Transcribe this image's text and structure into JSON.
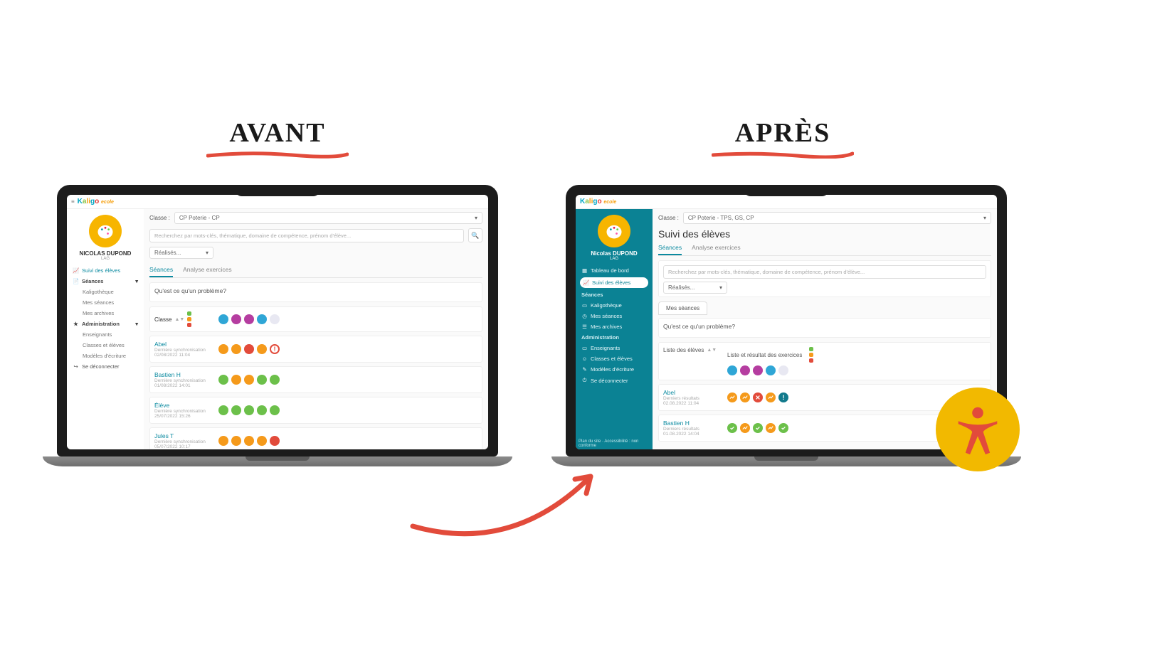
{
  "headings": {
    "before": "AVANT",
    "after": "APRÈS"
  },
  "brand": {
    "name": "Kaligo",
    "sub": "ecole"
  },
  "colors": {
    "teal_sidebar": "#0b8294",
    "accent_teal": "#0b8aa0",
    "badge_yellow": "#f2b900",
    "badge_icon": "#e24b3b"
  },
  "before": {
    "user": {
      "name": "NICOLAS DUPOND",
      "sub": "LAG"
    },
    "nav": {
      "suivi": "Suivi des élèves",
      "seances": "Séances",
      "kaligotheque": "Kaligothèque",
      "mes_seances": "Mes séances",
      "mes_archives": "Mes archives",
      "administration": "Administration",
      "enseignants": "Enseignants",
      "classes_eleves": "Classes et élèves",
      "modeles_ecriture": "Modèles d'écriture",
      "deconnecter": "Se déconnecter"
    },
    "classe_label": "Classe :",
    "classe_value": "CP Poterie - CP",
    "search_placeholder": "Recherchez par mots-clés, thématique, domaine de compétence, prénom d'élève...",
    "filter_value": "Réalisés...",
    "tabs": {
      "seances": "Séances",
      "analyse": "Analyse exercices"
    },
    "panel_title": "Qu'est ce qu'un problème?",
    "header_col1": "Classe",
    "students": [
      {
        "name": "Abel",
        "meta1": "Dernière synchronisation",
        "meta2": "02/08/2022 11:04"
      },
      {
        "name": "Bastien H",
        "meta1": "Dernière synchronisation",
        "meta2": "01/08/2022 14:01"
      },
      {
        "name": "Élève",
        "meta1": "Dernière synchronisation",
        "meta2": "25/07/2022 15:26"
      },
      {
        "name": "Jules T",
        "meta1": "Dernière synchronisation",
        "meta2": "05/07/2022 10:17"
      }
    ]
  },
  "after": {
    "user": {
      "name": "Nicolas DUPOND",
      "sub": "LAG"
    },
    "nav": {
      "tableau": "Tableau de bord",
      "suivi": "Suivi des élèves",
      "seances_section": "Séances",
      "kaligotheque": "Kaligothèque",
      "mes_seances": "Mes séances",
      "mes_archives": "Mes archives",
      "administration": "Administration",
      "enseignants": "Enseignants",
      "classes_eleves": "Classes et élèves",
      "modeles_ecriture": "Modèles d'écriture",
      "deconnecter": "Se déconnecter",
      "footer": "Plan du site · Accessibilité : non conforme"
    },
    "classe_label": "Classe :",
    "classe_value": "CP Poterie - TPS, GS, CP",
    "page_title": "Suivi des élèves",
    "tabs": {
      "seances": "Séances",
      "analyse": "Analyse exercices"
    },
    "search_placeholder": "Recherchez par mots-clés, thématique, domaine de compétence, prénom d'élève...",
    "filter_value": "Réalisés...",
    "pill_tab": "Mes séances",
    "panel_title": "Qu'est ce qu'un problème?",
    "col_liste": "Liste des élèves",
    "col_resultats": "Liste et résultat des exercices",
    "students": [
      {
        "name": "Abel",
        "meta1": "Derniers résultats",
        "meta2": "02.08.2022 11:04"
      },
      {
        "name": "Bastien H",
        "meta1": "Derniers résultats",
        "meta2": "01.08.2022 14:04"
      }
    ]
  }
}
